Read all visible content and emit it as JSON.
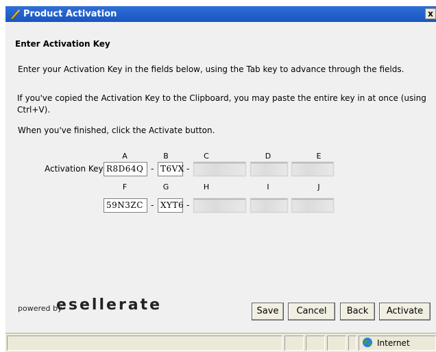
{
  "window": {
    "title": "Product Activation",
    "close_label": "x"
  },
  "main": {
    "heading": "Enter Activation Key",
    "instructions": [
      "Enter your Activation Key in the fields below, using the Tab key to advance through the fields.",
      "If you've copied the Activation Key to the Clipboard, you may paste the entire key in at once (using Ctrl+V).",
      "When you've finished, click the Activate button."
    ],
    "activation": {
      "label": "Activation Key:",
      "row1_headers": [
        "A",
        "B",
        "C",
        "D",
        "E"
      ],
      "row2_headers": [
        "F",
        "G",
        "H",
        "I",
        "J"
      ],
      "row1_values": [
        "R8D64Q",
        "T6VX",
        "",
        "",
        ""
      ],
      "row2_values": [
        "59N3ZC",
        "XYT6",
        "",
        "",
        ""
      ],
      "separator": "-"
    }
  },
  "footer": {
    "powered_by": "powered by",
    "brand": "esellerate",
    "buttons": {
      "save": "Save",
      "cancel": "Cancel",
      "back": "Back",
      "activate": "Activate"
    }
  },
  "statusbar": {
    "zone": "Internet",
    "zone_icon": "globe-icon"
  }
}
